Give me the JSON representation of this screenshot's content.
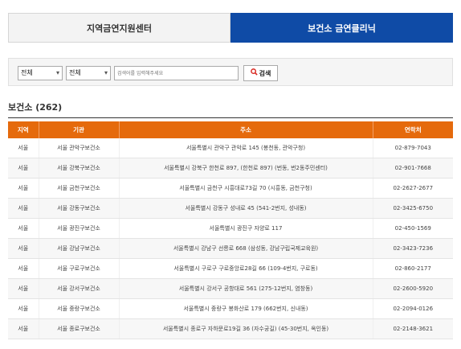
{
  "tabs": [
    {
      "label": "지역금연지원센터",
      "active": false
    },
    {
      "label": "보건소 금연클리닉",
      "active": true
    }
  ],
  "search": {
    "select1": "전체",
    "select2": "전체",
    "placeholder": "검색어를 입력해주세요",
    "button_label": "검색",
    "button_icon": "search-icon"
  },
  "heading": "보건소 (262)",
  "table": {
    "columns": [
      "지역",
      "기관",
      "주소",
      "연락처"
    ],
    "rows": [
      {
        "region": "서울",
        "org": "서울 관악구보건소",
        "address": "서울특별시 관악구 관악로 145 (봉천동, 관악구청)",
        "phone": "02-879-7043"
      },
      {
        "region": "서울",
        "org": "서울 강북구보건소",
        "address": "서울특별시 강북구 한천로 897, (한천로 897) (번동, 번2동주민센터)",
        "phone": "02-901-7668"
      },
      {
        "region": "서울",
        "org": "서울 금천구보건소",
        "address": "서울특별시 금천구 시흥대로73길 70 (시흥동, 금천구청)",
        "phone": "02-2627-2677"
      },
      {
        "region": "서울",
        "org": "서울 강동구보건소",
        "address": "서울특별시 강동구 성내로 45 (541-2번지, 성내동)",
        "phone": "02-3425-6750"
      },
      {
        "region": "서울",
        "org": "서울 광진구보건소",
        "address": "서울특별시 광진구 자양로 117",
        "phone": "02-450-1569"
      },
      {
        "region": "서울",
        "org": "서울 강남구보건소",
        "address": "서울특별시 강남구 선릉로 668 (삼성동, 강남구립국제교육원)",
        "phone": "02-3423-7236"
      },
      {
        "region": "서울",
        "org": "서울 구로구보건소",
        "address": "서울특별시 구로구 구로중앙로28길 66 (109-4번지, 구로동)",
        "phone": "02-860-2177"
      },
      {
        "region": "서울",
        "org": "서울 강서구보건소",
        "address": "서울특별시 강서구 공항대로 561 (275-12번지, 염창동)",
        "phone": "02-2600-5920"
      },
      {
        "region": "서울",
        "org": "서울 중랑구보건소",
        "address": "서울특별시 중랑구 봉화산로 179 (662번지, 신내동)",
        "phone": "02-2094-0126"
      },
      {
        "region": "서울",
        "org": "서울 종로구보건소",
        "address": "서울특별시 종로구 자하문로19길 36 (자수궁길) (45-30번지, 옥인동)",
        "phone": "02-2148-3621"
      }
    ]
  },
  "colors": {
    "tab_active": "#0f4ba6",
    "table_header": "#e56a0c",
    "search_icon": "#d8261f"
  }
}
